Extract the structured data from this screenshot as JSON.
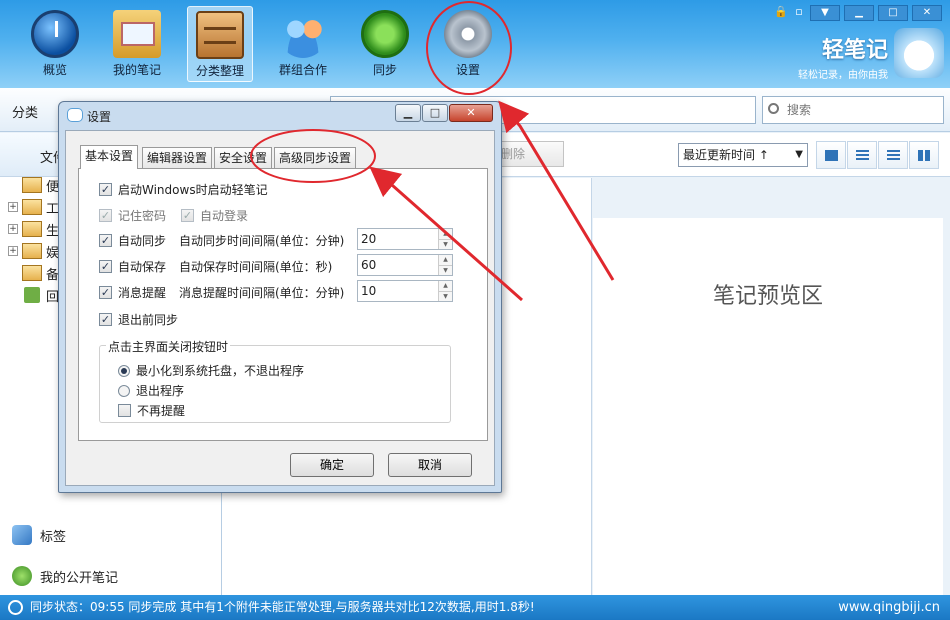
{
  "toolbar": {
    "items": [
      {
        "label": "概览"
      },
      {
        "label": "我的笔记"
      },
      {
        "label": "分类整理"
      },
      {
        "label": "群组合作"
      },
      {
        "label": "同步"
      },
      {
        "label": "设置"
      }
    ]
  },
  "window_controls": {
    "minimize": "▁",
    "maximize": "□",
    "close": "✕"
  },
  "brand": {
    "name": "轻笔记",
    "slogan": "轻松记录，由你由我"
  },
  "subbar": {
    "category_title": "分类",
    "search_placeholder": "搜索"
  },
  "left_panel": {
    "header": "文件夹",
    "tree": [
      {
        "label": "便"
      },
      {
        "label": "工"
      },
      {
        "label": "生"
      },
      {
        "label": "娱"
      },
      {
        "label": "备"
      },
      {
        "label": "回"
      }
    ],
    "tags_label": "标签",
    "public_notes_label": "我的公开笔记"
  },
  "list_bar": {
    "delete_label": "删除",
    "sort_value": "最近更新时间 ↑"
  },
  "preview": {
    "text": "笔记预览区"
  },
  "dialog": {
    "title": "设置",
    "tabs": [
      {
        "label": "基本设置"
      },
      {
        "label": "编辑器设置"
      },
      {
        "label": "安全设置"
      },
      {
        "label": "高级同步设置"
      }
    ],
    "options": {
      "start_with_windows": "启动Windows时启动轻笔记",
      "remember_password": "记住密码",
      "auto_login": "自动登录",
      "auto_sync": "自动同步",
      "auto_sync_interval_label": "自动同步时间间隔(单位：分钟)",
      "auto_sync_interval": "20",
      "auto_save": "自动保存",
      "auto_save_interval_label": "自动保存时间间隔(单位：秒)",
      "auto_save_interval": "60",
      "reminder": "消息提醒",
      "reminder_interval_label": "消息提醒时间间隔(单位：分钟)",
      "reminder_interval": "10",
      "sync_before_exit": "退出前同步"
    },
    "close_group": {
      "legend": "点击主界面关闭按钮时",
      "minimize_to_tray": "最小化到系统托盘，不退出程序",
      "exit_program": "退出程序",
      "no_reminder": "不再提醒"
    },
    "ok_label": "确定",
    "cancel_label": "取消"
  },
  "status": {
    "message": "同步状态：09:55 同步完成 其中有1个附件未能正常处理,与服务器共对比12次数据,用时1.8秒!",
    "website": "www.qingbiji.cn"
  },
  "colors": {
    "accent": "#2e9be6",
    "annotation": "#e0282e"
  }
}
